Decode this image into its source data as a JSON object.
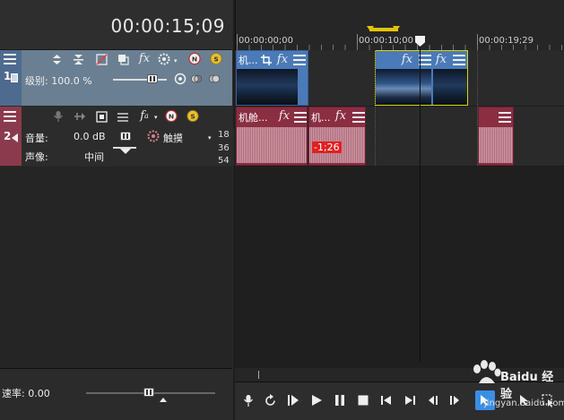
{
  "timecode": "00:00:15;09",
  "ruler": {
    "labels": [
      "00:00:00;00",
      "00:00:10;00",
      "00:00:19;29"
    ]
  },
  "video_track": {
    "number": "1",
    "level_label": "级别: 100.0 %",
    "clips": [
      {
        "title": "机..."
      },
      {
        "title": ""
      },
      {
        "title": ""
      }
    ]
  },
  "audio_track": {
    "number": "2",
    "volume_label": "音量:",
    "volume_value": "0.0 dB",
    "pan_label": "声像:",
    "pan_value": "中间",
    "mode_label": "触摸",
    "meter_labels": [
      "18",
      "36",
      "54"
    ],
    "clips": [
      {
        "title": "机舱..."
      },
      {
        "title": "机..."
      },
      {
        "title": ""
      }
    ],
    "badge": "-1;26"
  },
  "rate": {
    "label": "速率: 0.00"
  },
  "watermark": {
    "brand": "Baidu 经验",
    "url": "jingyan.baidu.com"
  },
  "colors": {
    "video_header": "#6a7f92",
    "video_strip": "#4e6b8f",
    "audio_strip": "#8b3a4d",
    "video_clip": "#4a7ab8",
    "audio_clip": "#8a2e42",
    "loop_region": "#e8c400",
    "badge": "#e02020"
  },
  "icons": {
    "fx": "fx-icon",
    "menu": "hamburger-menu-icon",
    "crop": "crop-icon"
  }
}
